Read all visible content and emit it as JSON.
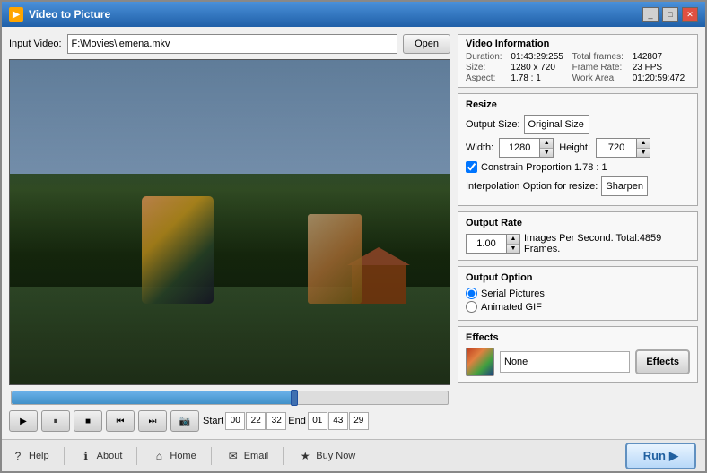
{
  "window": {
    "title": "Video to Picture",
    "icon": "▶"
  },
  "input": {
    "label": "Input Video:",
    "value": "F:\\Movies\\lemena.mkv",
    "open_btn": "Open"
  },
  "video_info": {
    "title": "Video Information",
    "duration_label": "Duration:",
    "duration_value": "01:43:29:255",
    "total_frames_label": "Total frames:",
    "total_frames_value": "142807",
    "size_label": "Size:",
    "size_value": "1280 x 720",
    "frame_rate_label": "Frame Rate:",
    "frame_rate_value": "23 FPS",
    "aspect_label": "Aspect:",
    "aspect_value": "1.78 : 1",
    "work_area_label": "Work Area:",
    "work_area_value": "01:20:59:472"
  },
  "resize": {
    "title": "Resize",
    "output_size_label": "Output Size:",
    "output_size_value": "Original Size",
    "width_label": "Width:",
    "width_value": "1280",
    "height_label": "Height:",
    "height_value": "720",
    "constrain_label": "Constrain Proportion 1.78 : 1",
    "interp_label": "Interpolation Option for resize:",
    "interp_value": "Sharpen"
  },
  "output_rate": {
    "title": "Output Rate",
    "rate_value": "1.00",
    "rate_text": "Images Per Second. Total:4859 Frames."
  },
  "output_option": {
    "title": "Output Option",
    "serial_label": "Serial Pictures",
    "animated_label": "Animated GIF"
  },
  "effects": {
    "title": "Effects",
    "effect_name": "None",
    "effects_btn": "Effects"
  },
  "controls": {
    "play": "▶",
    "pause": "⏸",
    "stop": "■",
    "prev": "⏮",
    "next": "⏭",
    "snapshot": "📷",
    "start_label": "Start",
    "start_h": "00",
    "start_m": "22",
    "start_s": "32",
    "end_label": "End",
    "end_h": "01",
    "end_m": "43",
    "end_s": "29"
  },
  "bottom": {
    "help": "Help",
    "about": "About",
    "home": "Home",
    "email": "Email",
    "buy_now": "Buy Now",
    "run": "Run"
  }
}
